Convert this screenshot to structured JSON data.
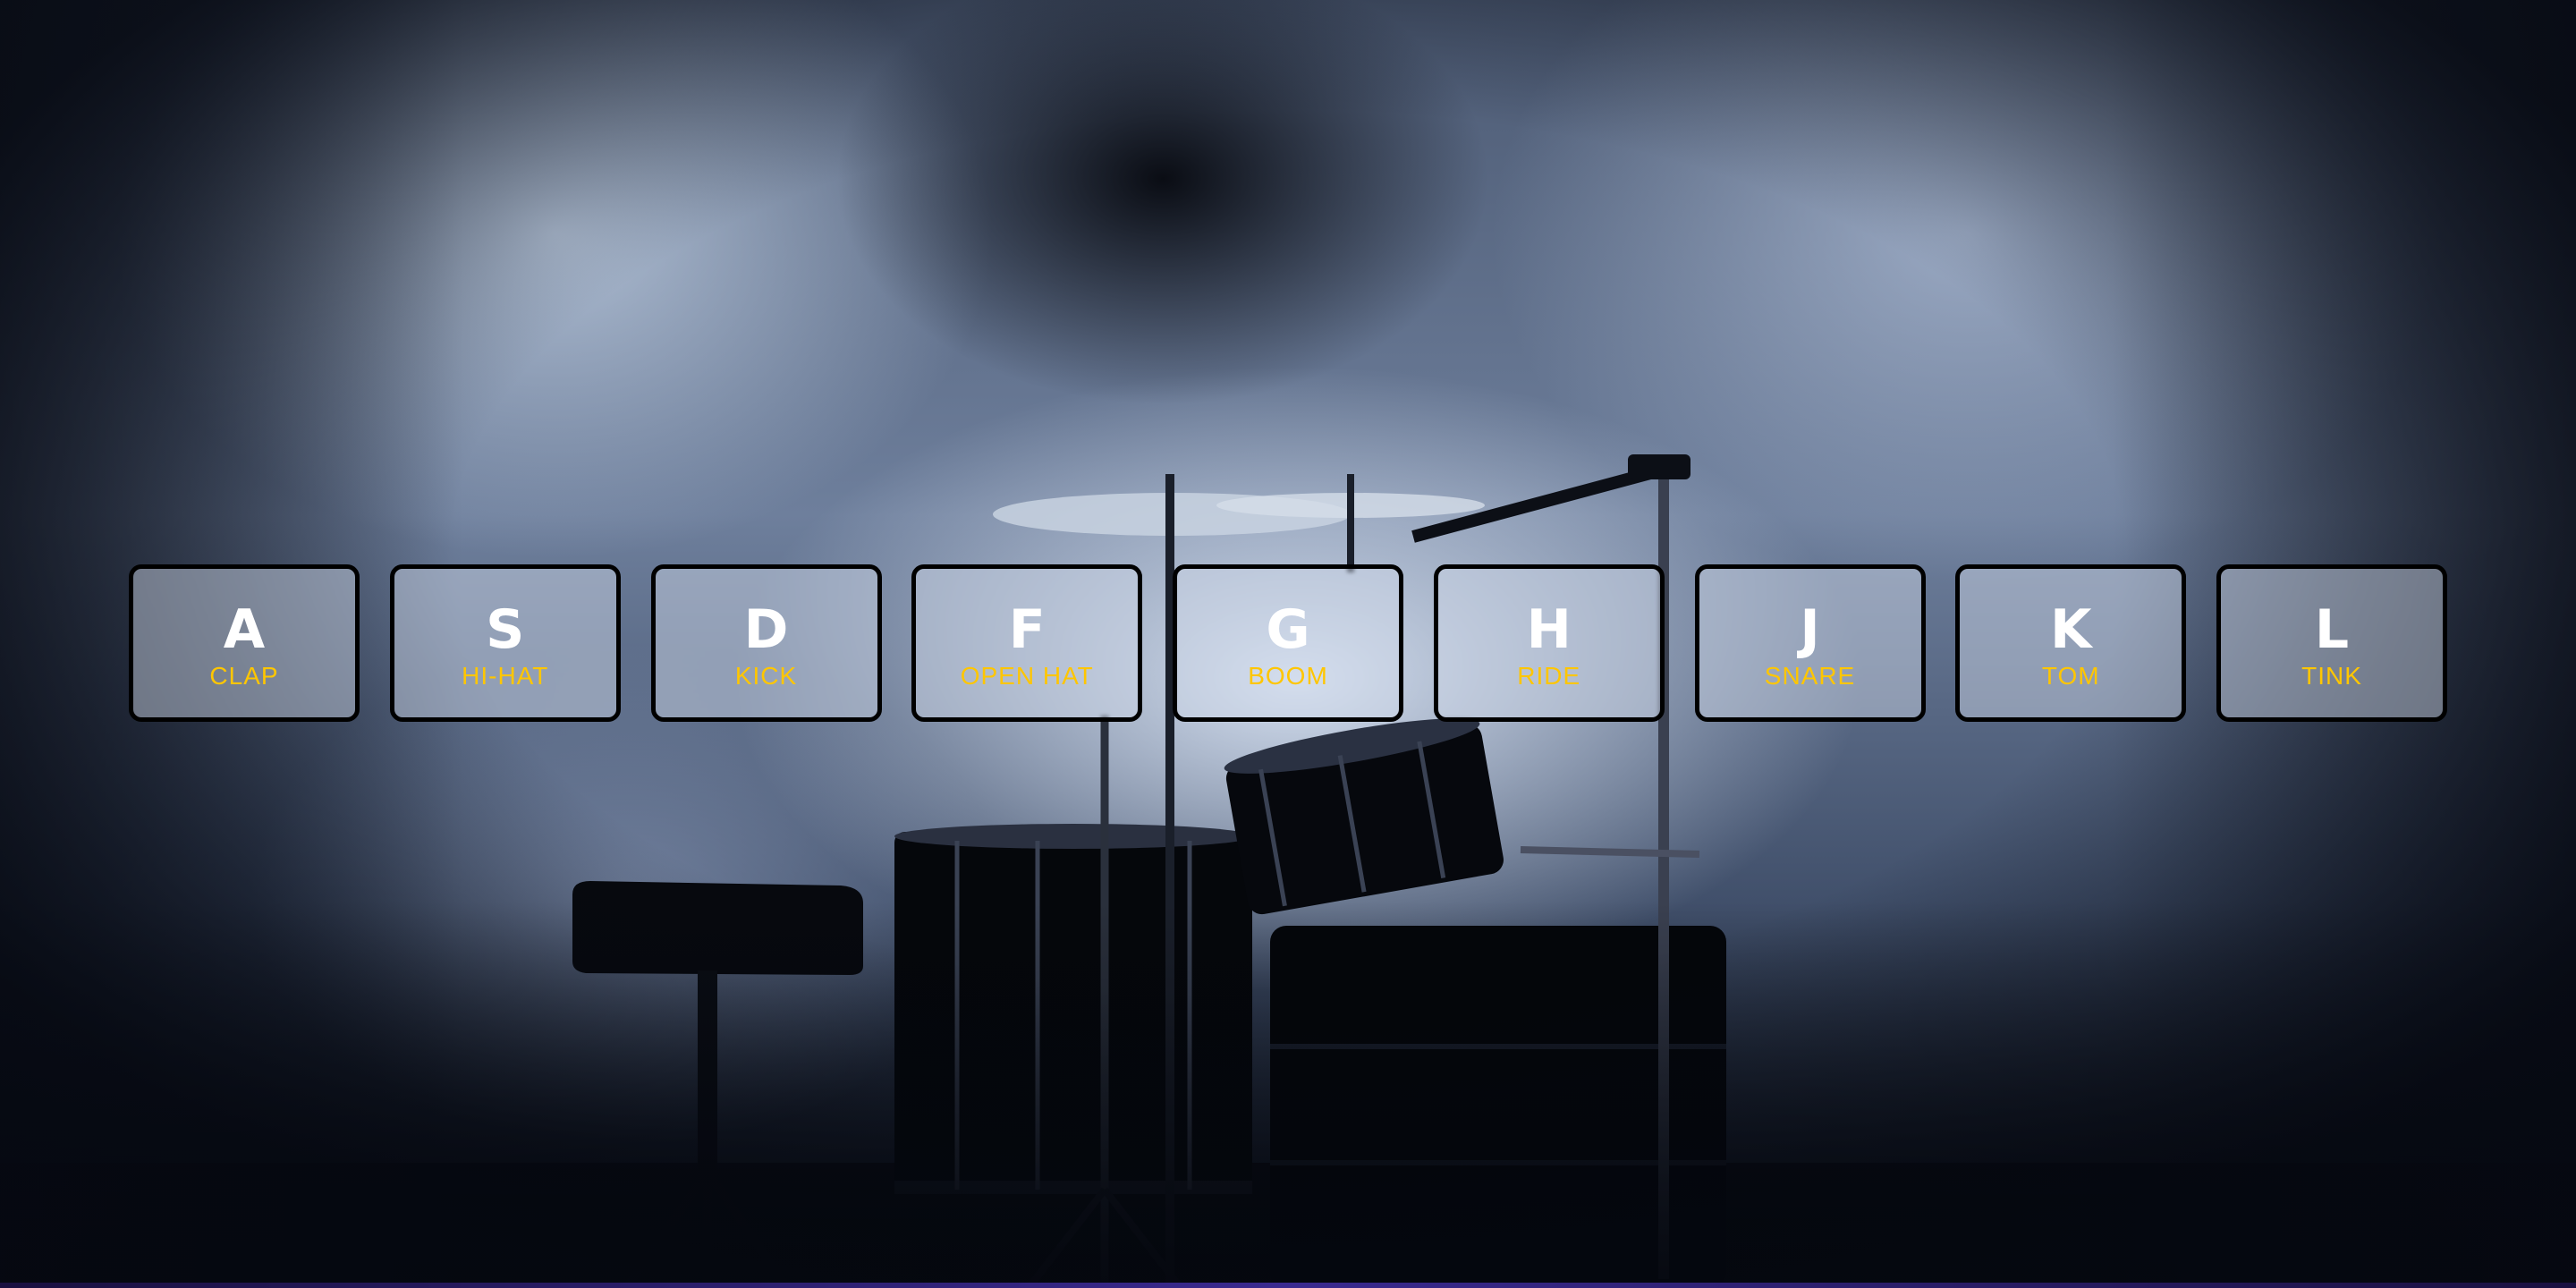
{
  "pads": [
    {
      "key": "A",
      "sound": "CLAP"
    },
    {
      "key": "S",
      "sound": "HI-HAT"
    },
    {
      "key": "D",
      "sound": "KICK"
    },
    {
      "key": "F",
      "sound": "OPEN HAT"
    },
    {
      "key": "G",
      "sound": "BOOM"
    },
    {
      "key": "H",
      "sound": "RIDE"
    },
    {
      "key": "J",
      "sound": "SNARE"
    },
    {
      "key": "K",
      "sound": "TOM"
    },
    {
      "key": "L",
      "sound": "TINK"
    }
  ],
  "colors": {
    "key_text": "#ffffff",
    "sound_text": "#ffc600",
    "pad_border": "#000000"
  },
  "background": {
    "icon": "drum-kit-photo"
  }
}
